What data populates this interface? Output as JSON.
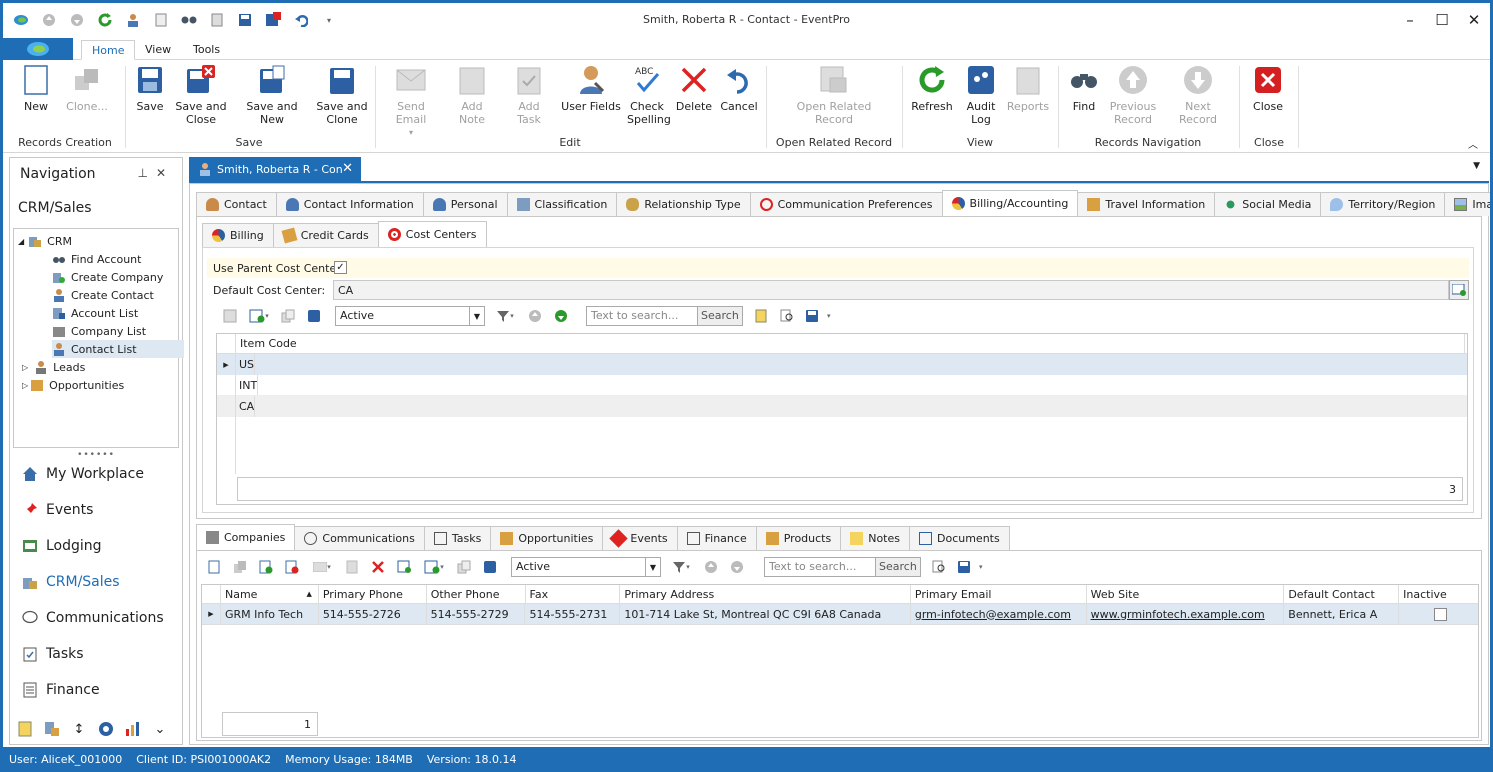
{
  "window": {
    "title": "Smith, Roberta R - Contact - EventPro"
  },
  "ribbon_tabs": [
    "Home",
    "View",
    "Tools"
  ],
  "ribbon": {
    "buttons": {
      "new": "New",
      "clone": "Clone...",
      "save": "Save",
      "save_close": "Save and Close",
      "save_new": "Save and New",
      "save_clone": "Save and Clone",
      "send_email": "Send Email",
      "add_note": "Add Note",
      "add_task": "Add Task",
      "user_fields": "User Fields",
      "check_spelling": "Check Spelling",
      "delete": "Delete",
      "cancel": "Cancel",
      "open_related": "Open Related Record",
      "refresh": "Refresh",
      "audit_log": "Audit Log",
      "reports": "Reports",
      "find": "Find",
      "prev_record": "Previous Record",
      "next_record": "Next Record",
      "close": "Close"
    },
    "groups": {
      "records_creation": "Records Creation",
      "save": "Save",
      "edit": "Edit",
      "open_related": "Open Related Record",
      "view": "View",
      "records_navigation": "Records Navigation",
      "close": "Close"
    }
  },
  "nav": {
    "title": "Navigation",
    "section": "CRM/Sales",
    "tree": {
      "crm": "CRM",
      "find_account": "Find Account",
      "create_company": "Create Company",
      "create_contact": "Create Contact",
      "account_list": "Account List",
      "company_list": "Company List",
      "contact_list": "Contact List",
      "leads": "Leads",
      "opportunities": "Opportunities"
    },
    "big": {
      "my_workplace": "My Workplace",
      "events": "Events",
      "lodging": "Lodging",
      "crm_sales": "CRM/Sales",
      "communications": "Communications",
      "tasks": "Tasks",
      "finance": "Finance"
    }
  },
  "doc_tab": "Smith, Roberta R - Con",
  "contact_tabs": [
    "Contact",
    "Contact Information",
    "Personal",
    "Classification",
    "Relationship Type",
    "Communication Preferences",
    "Billing/Accounting",
    "Travel Information",
    "Social Media",
    "Territory/Region",
    "Image"
  ],
  "billing_tabs": [
    "Billing",
    "Credit Cards",
    "Cost Centers"
  ],
  "cost_centers": {
    "use_parent_label": "Use Parent Cost Center",
    "default_label": "Default Cost Center:",
    "default_value": "CA",
    "filter": "Active",
    "search_placeholder": "Text to search...",
    "search_button": "Search",
    "column": "Item Code",
    "rows": [
      "US",
      "INT",
      "CA"
    ],
    "count": "3"
  },
  "bottom_tabs": [
    "Companies",
    "Communications",
    "Tasks",
    "Opportunities",
    "Events",
    "Finance",
    "Products",
    "Notes",
    "Documents"
  ],
  "companies": {
    "filter": "Active",
    "search_placeholder": "Text to search...",
    "search_button": "Search",
    "columns": [
      "Name",
      "Primary Phone",
      "Other Phone",
      "Fax",
      "Primary Address",
      "Primary Email",
      "Web Site",
      "Default Contact",
      "Inactive"
    ],
    "row": {
      "name": "GRM Info Tech",
      "primary_phone": "514-555-2726",
      "other_phone": "514-555-2729",
      "fax": "514-555-2731",
      "address": "101-714 Lake St, Montreal QC C9I 6A8 Canada",
      "email": "grm-infotech@example.com",
      "web": "www.grminfotech.example.com",
      "default_contact": "Bennett, Erica A"
    },
    "count": "1"
  },
  "status": {
    "user": "User: AliceK_001000",
    "client": "Client ID: PSI001000AK2",
    "memory": "Memory Usage: 184MB",
    "version": "Version: 18.0.14"
  }
}
